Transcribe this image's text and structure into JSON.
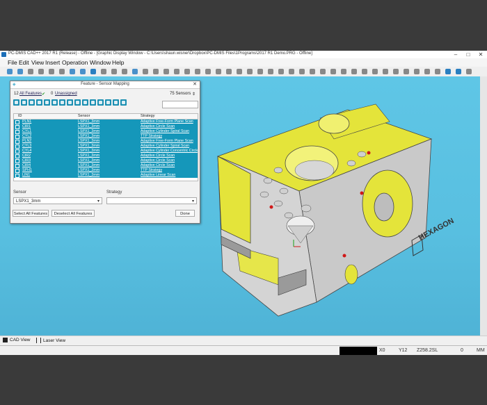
{
  "window": {
    "title": "PC-DMIS CAD++ 2017 R1 (Release) - Offline - [Graphic Display Window - C:\\Users\\shaun.wisner\\Dropbox\\PC-DMIS Files\\1Programs\\2017 R1 Demo.PRG - Offline]"
  },
  "menu": [
    "File",
    "Edit",
    "View",
    "Insert",
    "Operation",
    "Window",
    "Help"
  ],
  "dialog": {
    "title": "Feature - Sensor Mapping",
    "features_count": "12",
    "all_features": "All Features",
    "unassigned_count": "0",
    "unassigned": "Unassigned",
    "sensors": "75 Sensors",
    "columns": [
      "ID",
      "Sensor",
      "Strategy"
    ],
    "rows": [
      {
        "id": "PLN1",
        "sensor": "LSPX1_3mm",
        "strategy": "Adaptive Free-Form Plane Scan"
      },
      {
        "id": "CIR1",
        "sensor": "LSPX1_3mm",
        "strategy": "Adaptive Circle Scan"
      },
      {
        "id": "CYL1",
        "sensor": "LSPX1_3mm",
        "strategy": "Adaptive Cylinder Spiral Scan"
      },
      {
        "id": "CYL2",
        "sensor": "LSPX1_3mm",
        "strategy": "TTP Strategy"
      },
      {
        "id": "PLN2",
        "sensor": "LSPX1_3mm",
        "strategy": "Adaptive Free-Form Plane Scan"
      },
      {
        "id": "CYL3",
        "sensor": "LSPX1_3mm",
        "strategy": "Adaptive Cylinder Spiral Scan"
      },
      {
        "id": "CYL4",
        "sensor": "LSPX1_3mm",
        "strategy": "Adaptive Cylinder Concentric Circle"
      },
      {
        "id": "CIR2",
        "sensor": "LSPX1_3mm",
        "strategy": "Adaptive Circle Scan"
      },
      {
        "id": "CIR3",
        "sensor": "LSPX1_3mm",
        "strategy": "Adaptive Circle Scan"
      },
      {
        "id": "CIR4",
        "sensor": "LSPX1_3mm",
        "strategy": "Adaptive Circle Scan"
      },
      {
        "id": "SPH1",
        "sensor": "LSPX1_3mm",
        "strategy": "TTP Strategy"
      },
      {
        "id": "LIN1",
        "sensor": "LSPX1_3mm",
        "strategy": "Adaptive Linear Scan"
      }
    ],
    "sensor_label": "Sensor",
    "sensor_value": "LSPX1_3mm",
    "strategy_label": "Strategy",
    "strategy_value": "",
    "select_all": "Select All Features",
    "deselect_all": "Deselect All Features",
    "done": "Done"
  },
  "model": {
    "logo_text": "HEXAGON"
  },
  "tabs": [
    "CAD View",
    "Laser View"
  ],
  "status": {
    "x": "X0",
    "y": "Y12",
    "z": "Z258.2SL",
    "val": "0",
    "units": "MM"
  },
  "colors": {
    "accent": "#1597ba",
    "viewport": "#5cc3e4",
    "part_yellow": "#e5e53a",
    "part_gray": "#c9c9c9"
  }
}
